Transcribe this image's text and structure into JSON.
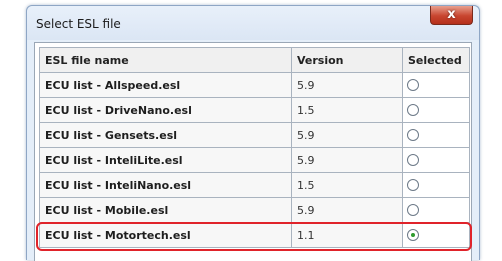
{
  "dialog": {
    "title": "Select ESL file",
    "close_label": "x"
  },
  "table": {
    "headers": {
      "name": "ESL file name",
      "version": "Version",
      "selected": "Selected"
    },
    "rows": [
      {
        "name": "ECU list - Allspeed.esl",
        "version": "5.9",
        "selected": false
      },
      {
        "name": "ECU list - DriveNano.esl",
        "version": "1.5",
        "selected": false
      },
      {
        "name": "ECU list - Gensets.esl",
        "version": "5.9",
        "selected": false
      },
      {
        "name": "ECU list - InteliLite.esl",
        "version": "5.9",
        "selected": false
      },
      {
        "name": "ECU list - InteliNano.esl",
        "version": "1.5",
        "selected": false
      },
      {
        "name": "ECU list - Mobile.esl",
        "version": "5.9",
        "selected": false
      },
      {
        "name": "ECU list - Motortech.esl",
        "version": "1.1",
        "selected": true
      }
    ]
  },
  "colors": {
    "highlight": "#e0232a",
    "selected_radio_dot": "#2f9b2f",
    "close_button": "#c8452f"
  }
}
